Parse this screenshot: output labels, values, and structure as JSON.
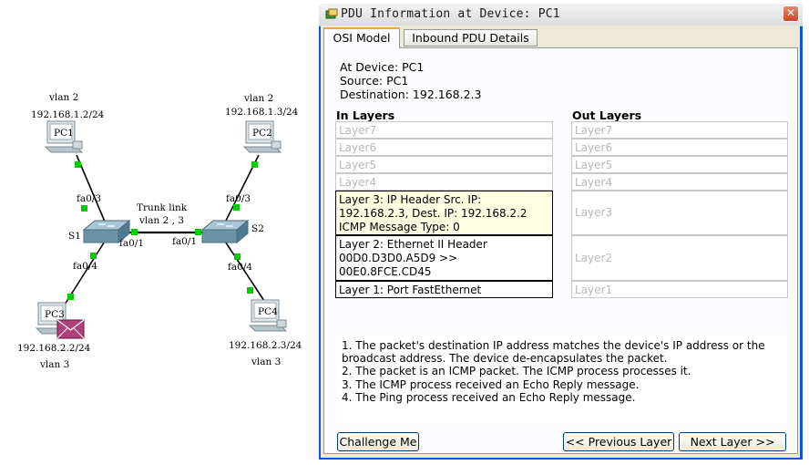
{
  "topology": {
    "pc1": {
      "name": "PC1",
      "vlan": "vlan 2",
      "ip": "192.168.1.2/24"
    },
    "pc2": {
      "name": "PC2",
      "vlan": "vlan 2",
      "ip": "192.168.1.3/24"
    },
    "pc3": {
      "name": "PC3",
      "vlan": "vlan 3",
      "ip": "192.168.2.2/24"
    },
    "pc4": {
      "name": "PC4",
      "vlan": "vlan 3",
      "ip": "192.168.2.3/24"
    },
    "s1": {
      "name": "S1"
    },
    "s2": {
      "name": "S2"
    },
    "trunk_label_1": "Trunk link",
    "trunk_label_2": "vlan 2 , 3",
    "ports": {
      "s1_pc1": "fa0/3",
      "s1_pc3": "fa0/4",
      "s1_trunk": "fa0/1",
      "s2_trunk": "fa0/1",
      "s2_pc2": "fa0/3",
      "s2_pc4": "fa0/4"
    },
    "colors": {
      "link_dot": "#00cc00",
      "envelope": "#b0407a",
      "link": "#000000"
    }
  },
  "dialog": {
    "title": "PDU Information at Device: PC1",
    "close_label": "✕",
    "tabs": [
      {
        "label": "OSI Model",
        "selected": true
      },
      {
        "label": "Inbound PDU Details",
        "selected": false
      }
    ],
    "at_device": "At Device: PC1",
    "source": "Source: PC1",
    "destination": "Destination: 192.168.2.3",
    "in_layers_header": "In Layers",
    "out_layers_header": "Out Layers",
    "in_layers": {
      "l7": "Layer7",
      "l6": "Layer6",
      "l5": "Layer5",
      "l4": "Layer4",
      "l3": "Layer 3: IP Header Src. IP: 192.168.2.3, Dest. IP: 192.168.2.2 ICMP Message Type: 0",
      "l2": "Layer 2: Ethernet II Header 00D0.D3D0.A5D9 >> 00E0.8FCE.CD45",
      "l1": "Layer 1: Port FastEthernet"
    },
    "out_layers": {
      "l7": "Layer7",
      "l6": "Layer6",
      "l5": "Layer5",
      "l4": "Layer4",
      "l3": "Layer3",
      "l2": "Layer2",
      "l1": "Layer1"
    },
    "description": [
      "1. The packet's destination IP address matches the device's IP address or the broadcast address. The device de-encapsulates the packet.",
      "2. The packet is an ICMP packet. The ICMP process processes it.",
      "3. The ICMP process received an Echo Reply message.",
      "4. The Ping process received an Echo Reply message."
    ],
    "buttons": {
      "challenge": "Challenge Me",
      "previous": "<< Previous Layer",
      "next": "Next Layer >>"
    },
    "colors": {
      "titlebar_frame": "#0a54e4",
      "active_tab_accent": "#f1a63a",
      "layer3_highlight": "#ffffe1"
    }
  }
}
